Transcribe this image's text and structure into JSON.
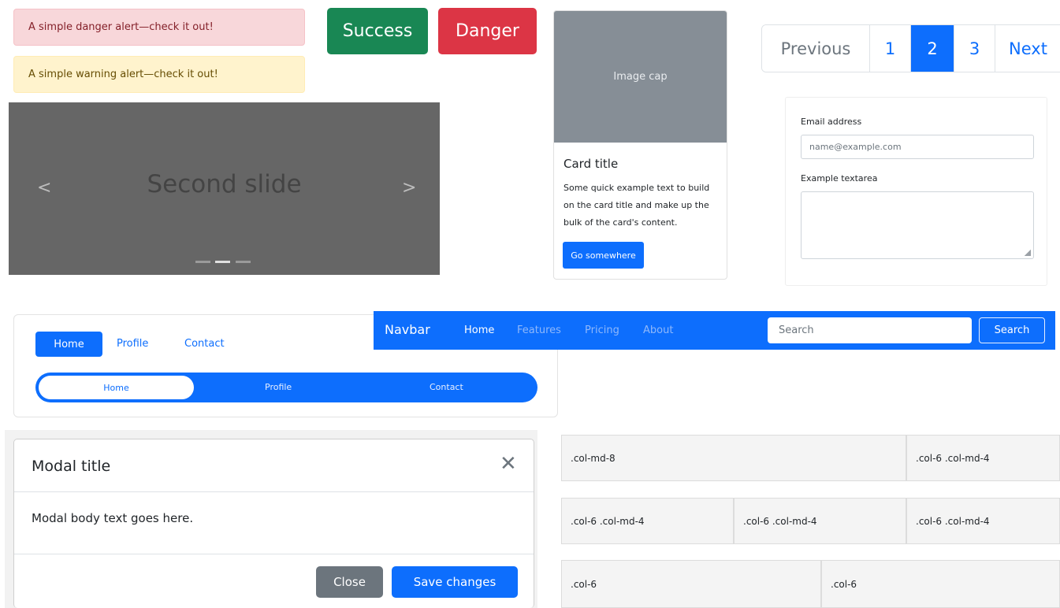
{
  "alerts": {
    "danger": "A simple danger alert—check it out!",
    "warning": "A simple warning alert—check it out!"
  },
  "buttons": {
    "success": "Success",
    "danger": "Danger"
  },
  "carousel": {
    "caption": "Second slide",
    "prev_icon": "chevron-left-icon",
    "next_icon": "chevron-right-icon",
    "indicator_count": 3,
    "active_index": 1
  },
  "card": {
    "image_cap": "Image cap",
    "title": "Card title",
    "text": "Some quick example text to build on the card title and make up the bulk of the card's content.",
    "button": "Go somewhere"
  },
  "pagination": {
    "previous": "Previous",
    "pages": [
      "1",
      "2",
      "3"
    ],
    "active_page": "2",
    "next": "Next"
  },
  "form": {
    "email_label": "Email address",
    "email_placeholder": "name@example.com",
    "textarea_label": "Example textarea"
  },
  "nav_pills": {
    "items": [
      "Home",
      "Profile",
      "Contact"
    ],
    "active": "Home"
  },
  "nav_fill": {
    "items": [
      "Home",
      "Profile",
      "Contact"
    ],
    "active": "Home"
  },
  "navbar": {
    "brand": "Navbar",
    "links": [
      "Home",
      "Features",
      "Pricing",
      "About"
    ],
    "active": "Home",
    "search_placeholder": "Search",
    "search_button": "Search"
  },
  "modal": {
    "title": "Modal title",
    "close_icon": "close-icon",
    "body": "Modal body text goes here.",
    "close_button": "Close",
    "save_button": "Save changes"
  },
  "grid": {
    "row1": [
      ".col-md-8",
      ".col-6 .col-md-4"
    ],
    "row2": [
      ".col-6 .col-md-4",
      ".col-6 .col-md-4",
      ".col-6 .col-md-4"
    ],
    "row3": [
      ".col-6",
      ".col-6"
    ]
  },
  "colors": {
    "primary": "#0d6efd",
    "success": "#198754",
    "danger": "#dc3545",
    "secondary": "#6c757d"
  }
}
